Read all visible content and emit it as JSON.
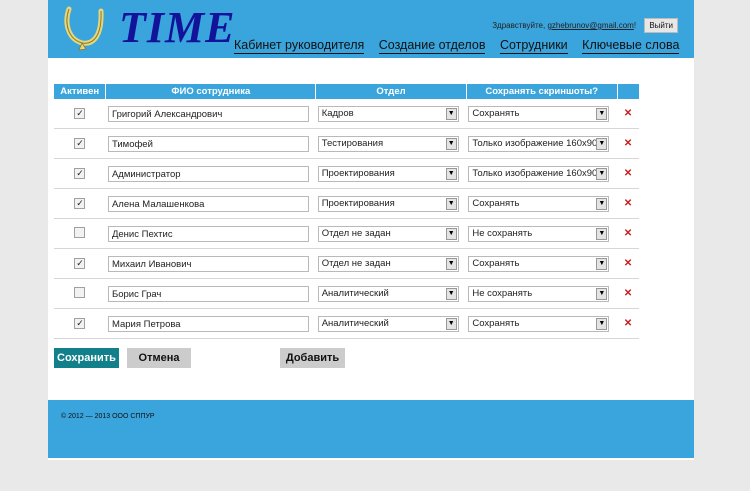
{
  "header": {
    "logo_text": "TIME",
    "greeting": "Здравствуйте,",
    "user_email": "gzhebrunov@gmail.com",
    "greeting_end": "!",
    "logout_label": "Выйти",
    "nav": [
      "Кабинет руководителя",
      "Создание отделов",
      "Сотрудники",
      "Ключевые слова"
    ]
  },
  "table": {
    "headers": [
      "Активен",
      "ФИО сотрудника",
      "Отдел",
      "Сохранять скриншоты?"
    ],
    "rows": [
      {
        "active": true,
        "name": "Григорий Александрович",
        "dept": "Кадров",
        "screens": "Сохранять"
      },
      {
        "active": true,
        "name": "Тимофей",
        "dept": "Тестирования",
        "screens": "Только изображение 160x90"
      },
      {
        "active": true,
        "name": "Администратор",
        "dept": "Проектирования",
        "screens": "Только изображение 160x90"
      },
      {
        "active": true,
        "name": "Алена Малашенкова",
        "dept": "Проектирования",
        "screens": "Сохранять"
      },
      {
        "active": false,
        "name": "Денис Пехтис",
        "dept": "Отдел не задан",
        "screens": "Не сохранять"
      },
      {
        "active": true,
        "name": "Михаил Иванович",
        "dept": "Отдел не задан",
        "screens": "Сохранять"
      },
      {
        "active": false,
        "name": "Борис Грач",
        "dept": "Аналитический",
        "screens": "Не сохранять"
      },
      {
        "active": true,
        "name": "Мария Петрова",
        "dept": "Аналитический",
        "screens": "Сохранять"
      }
    ]
  },
  "actions": {
    "save": "Сохранить",
    "cancel": "Отмена",
    "add": "Добавить"
  },
  "footer": {
    "copyright": "© 2012 — 2013 ООО СППУР"
  },
  "colors": {
    "brand": "#3aa4dd",
    "save_button": "#12808a",
    "delete": "#cc1a1a"
  },
  "icons": {
    "logo": "horseshoe-icon",
    "delete": "close-icon",
    "dropdown": "chevron-down-icon"
  }
}
